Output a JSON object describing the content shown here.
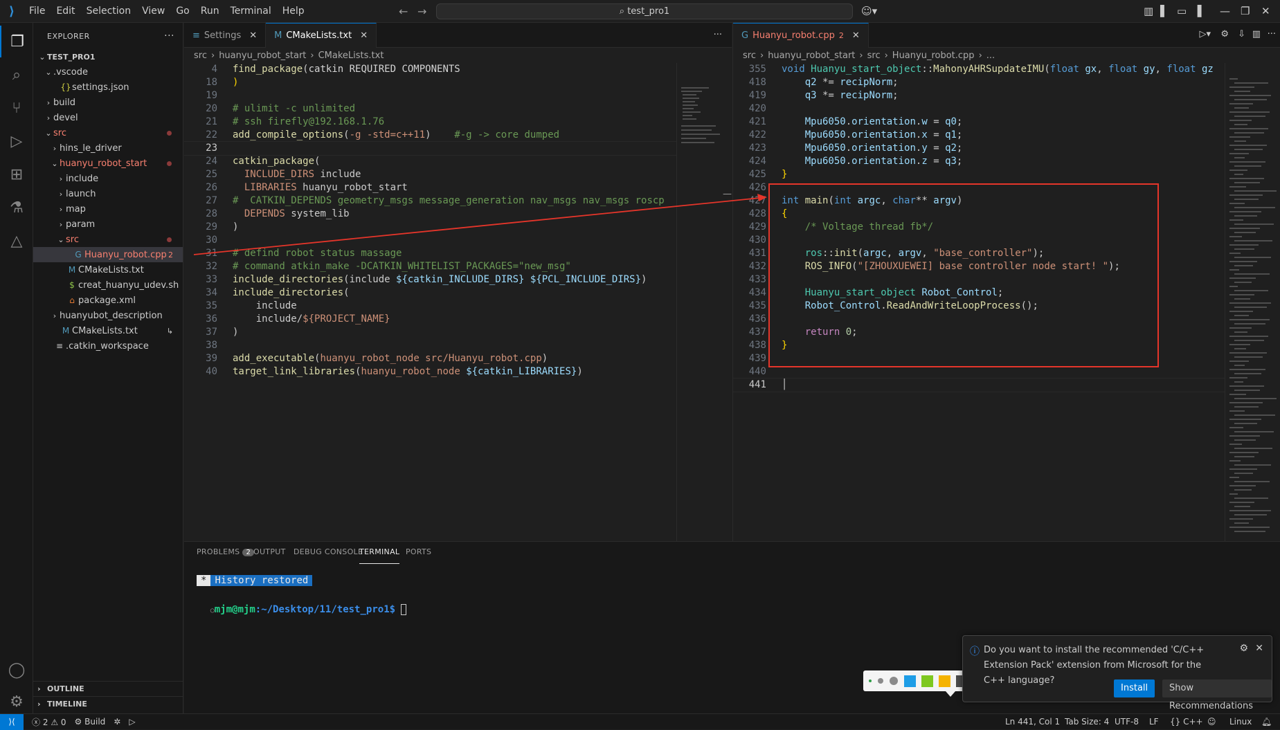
{
  "window": {
    "search_text": "test_pro1",
    "menu": [
      "File",
      "Edit",
      "Selection",
      "View",
      "Go",
      "Run",
      "Terminal",
      "Help"
    ]
  },
  "sidebar": {
    "title": "EXPLORER",
    "more": "···",
    "tree": [
      {
        "label": "TEST_PRO1",
        "depth": 0,
        "chev": "⌄",
        "icon": "",
        "bold": true
      },
      {
        "label": ".vscode",
        "depth": 1,
        "chev": "⌄",
        "icon": ""
      },
      {
        "label": "settings.json",
        "depth": 2,
        "chev": "",
        "icon": "{}",
        "iconColor": "#cbcb41"
      },
      {
        "label": "build",
        "depth": 1,
        "chev": "›",
        "icon": ""
      },
      {
        "label": "devel",
        "depth": 1,
        "chev": "›",
        "icon": ""
      },
      {
        "label": "src",
        "depth": 1,
        "chev": "⌄",
        "icon": "",
        "red": true,
        "dot": true
      },
      {
        "label": "hins_le_driver",
        "depth": 2,
        "chev": "›",
        "icon": ""
      },
      {
        "label": "huanyu_robot_start",
        "depth": 2,
        "chev": "⌄",
        "icon": "",
        "red": true,
        "dot": true
      },
      {
        "label": "include",
        "depth": 3,
        "chev": "›",
        "icon": ""
      },
      {
        "label": "launch",
        "depth": 3,
        "chev": "›",
        "icon": ""
      },
      {
        "label": "map",
        "depth": 3,
        "chev": "›",
        "icon": ""
      },
      {
        "label": "param",
        "depth": 3,
        "chev": "›",
        "icon": ""
      },
      {
        "label": "src",
        "depth": 3,
        "chev": "⌄",
        "icon": "",
        "red": true,
        "dot": true
      },
      {
        "label": "Huanyu_robot.cpp",
        "depth": 4,
        "chev": "",
        "icon": "G",
        "iconColor": "#519aba",
        "red": true,
        "badge": "2",
        "selected": true
      },
      {
        "label": "CMakeLists.txt",
        "depth": 3,
        "chev": "",
        "icon": "M",
        "iconColor": "#519aba"
      },
      {
        "label": "creat_huanyu_udev.sh",
        "depth": 3,
        "chev": "",
        "icon": "$",
        "iconColor": "#8dc149"
      },
      {
        "label": "package.xml",
        "depth": 3,
        "chev": "",
        "icon": "⌂",
        "iconColor": "#e37933"
      },
      {
        "label": "huanyubot_description",
        "depth": 2,
        "chev": "›",
        "icon": ""
      },
      {
        "label": "CMakeLists.txt",
        "depth": 2,
        "chev": "",
        "icon": "M",
        "iconColor": "#519aba",
        "badge": "↳"
      },
      {
        "label": ".catkin_workspace",
        "depth": 1,
        "chev": "",
        "icon": "≡",
        "iconColor": "#cccccc"
      }
    ],
    "outline": "OUTLINE",
    "timeline": "TIMELINE"
  },
  "left_editor": {
    "tabs": [
      {
        "label": "Settings",
        "icon": "≡",
        "active": false
      },
      {
        "label": "CMakeLists.txt",
        "icon": "M",
        "active": true
      }
    ],
    "more": "···",
    "breadcrumb": [
      "src",
      "huanyu_robot_start",
      "CMakeLists.txt"
    ],
    "lines": [
      {
        "n": "4",
        "html": "<span class='f'>find_package</span>(<span class='o'>catkin REQUIRED COMPONENTS</span>"
      },
      {
        "n": "18",
        "html": "<span class='y'>)</span>"
      },
      {
        "n": "19",
        "html": ""
      },
      {
        "n": "20",
        "html": "<span class='c'># ulimit -c unlimited</span>"
      },
      {
        "n": "21",
        "html": "<span class='c'># ssh firefly@192.168.1.76</span>"
      },
      {
        "n": "22",
        "html": "<span class='f'>add_compile_options</span>(<span class='s'>-g -std=c++11</span>)    <span class='c'>#-g -> core dumped</span>"
      },
      {
        "n": "23",
        "html": "",
        "cur": true
      },
      {
        "n": "24",
        "html": "<span class='f'>catkin_package</span>("
      },
      {
        "n": "25",
        "html": "  <span class='s'>INCLUDE_DIRS</span> include"
      },
      {
        "n": "26",
        "html": "  <span class='s'>LIBRARIES</span> huanyu_robot_start"
      },
      {
        "n": "27",
        "html": "<span class='c'>#  CATKIN_DEPENDS geometry_msgs message_generation nav_msgs nav_msgs roscp</span>"
      },
      {
        "n": "28",
        "html": "  <span class='s'>DEPENDS</span> system_lib"
      },
      {
        "n": "29",
        "html": ")"
      },
      {
        "n": "30",
        "html": ""
      },
      {
        "n": "31",
        "html": "<span class='c'># defind robot status massage</span>"
      },
      {
        "n": "32",
        "html": "<span class='c'># command atkin_make -DCATKIN_WHITELIST_PACKAGES=\"new_msg\"</span>"
      },
      {
        "n": "33",
        "html": "<span class='f'>include_directories</span>(include <span class='v'>${catkin_INCLUDE_DIRS}</span> <span class='v'>${PCL_INCLUDE_DIRS}</span>)"
      },
      {
        "n": "34",
        "html": "<span class='f'>include_directories</span>("
      },
      {
        "n": "35",
        "html": "    include"
      },
      {
        "n": "36",
        "html": "    include/<span class='s'>${PROJECT_NAME}</span>"
      },
      {
        "n": "37",
        "html": ")"
      },
      {
        "n": "38",
        "html": ""
      },
      {
        "n": "39",
        "html": "<span class='f'>add_executable</span>(<span class='s'>huanyu_robot_node src/Huanyu_robot.cpp</span>)"
      },
      {
        "n": "40",
        "html": "<span class='f'>target_link_libraries</span>(<span class='s'>huanyu_robot_node</span> <span class='v'>${catkin_LIBRARIES}</span>)"
      }
    ]
  },
  "right_editor": {
    "tabs": [
      {
        "label": "Huanyu_robot.cpp",
        "icon": "G",
        "active": true,
        "badge": "2"
      }
    ],
    "breadcrumb": [
      "src",
      "huanyu_robot_start",
      "src",
      "Huanyu_robot.cpp",
      "..."
    ],
    "lines": [
      {
        "n": "355",
        "html": "<span class='k'>void</span> <span class='t'>Huanyu_start_object</span>::<span class='f'>MahonyAHRSupdateIMU</span>(<span class='k'>float</span> <span class='v'>gx</span>, <span class='k'>float</span> <span class='v'>gy</span>, <span class='k'>float</span> <span class='v'>gz</span>"
      },
      {
        "n": "418",
        "html": "    <span class='v'>q2</span> *= <span class='v'>recipNorm</span>;"
      },
      {
        "n": "419",
        "html": "    <span class='v'>q3</span> *= <span class='v'>recipNorm</span>;"
      },
      {
        "n": "420",
        "html": ""
      },
      {
        "n": "421",
        "html": "    <span class='v'>Mpu6050</span>.<span class='v'>orientation</span>.<span class='v'>w</span> = <span class='v'>q0</span>;"
      },
      {
        "n": "422",
        "html": "    <span class='v'>Mpu6050</span>.<span class='v'>orientation</span>.<span class='v'>x</span> = <span class='v'>q1</span>;"
      },
      {
        "n": "423",
        "html": "    <span class='v'>Mpu6050</span>.<span class='v'>orientation</span>.<span class='v'>y</span> = <span class='v'>q2</span>;"
      },
      {
        "n": "424",
        "html": "    <span class='v'>Mpu6050</span>.<span class='v'>orientation</span>.<span class='v'>z</span> = <span class='v'>q3</span>;"
      },
      {
        "n": "425",
        "html": "<span class='y'>}</span>"
      },
      {
        "n": "426",
        "html": ""
      },
      {
        "n": "427",
        "html": "<span class='k'>int</span> <span class='f'>main</span>(<span class='k'>int</span> <span class='v'>argc</span>, <span class='k'>char</span>** <span class='v'>argv</span>)"
      },
      {
        "n": "428",
        "html": "<span class='y'>{</span>"
      },
      {
        "n": "429",
        "html": "    <span class='c'>/* Voltage thread fb*/</span>"
      },
      {
        "n": "430",
        "html": ""
      },
      {
        "n": "431",
        "html": "    <span class='t'>ros</span>::<span class='f'>init</span>(<span class='v'>argc</span>, <span class='v'>argv</span>, <span class='s'>\"base_controller\"</span>);"
      },
      {
        "n": "432",
        "html": "    <span class='f'>ROS_INFO</span>(<span class='s'>\"[ZHOUXUEWEI] base controller node start! \"</span>);"
      },
      {
        "n": "433",
        "html": ""
      },
      {
        "n": "434",
        "html": "    <span class='t'>Huanyu_start_object</span> <span class='v'>Robot_Control</span>;"
      },
      {
        "n": "435",
        "html": "    <span class='v'>Robot_Control</span>.<span class='f'>ReadAndWriteLoopProcess</span>();"
      },
      {
        "n": "436",
        "html": ""
      },
      {
        "n": "437",
        "html": "    <span class='m'>return</span> <span class='n'>0</span>;"
      },
      {
        "n": "438",
        "html": "<span class='y'>}</span>"
      },
      {
        "n": "439",
        "html": ""
      },
      {
        "n": "440",
        "html": ""
      },
      {
        "n": "441",
        "html": "",
        "cur": true
      }
    ]
  },
  "panel": {
    "tabs": [
      {
        "label": "PROBLEMS",
        "badge": "2"
      },
      {
        "label": "OUTPUT"
      },
      {
        "label": "DEBUG CONSOLE"
      },
      {
        "label": "TERMINAL",
        "active": true
      },
      {
        "label": "PORTS"
      }
    ],
    "history": "History restored",
    "history_marker": "*",
    "prompt_user": "mjm@mjm",
    "prompt_path": ":~/Desktop/11/test_pro1$ "
  },
  "notification": {
    "message": "Do you want to install the recommended 'C/C++ Extension Pack' extension from Microsoft for the C++ language?",
    "install": "Install",
    "recommend": "Show Recommendations"
  },
  "palette_colors": [
    "#1e9de6",
    "#7ec820",
    "#f5b300",
    "#4a4a4a",
    "#ffffff",
    "#ef4d4d"
  ],
  "status": {
    "errors": "2",
    "warnings": "0",
    "build": "Build",
    "ln_col": "Ln 441, Col 1",
    "tab_size": "Tab Size: 4",
    "encoding": "UTF-8",
    "eol": "LF",
    "language": "C++",
    "platform": "Linux"
  }
}
